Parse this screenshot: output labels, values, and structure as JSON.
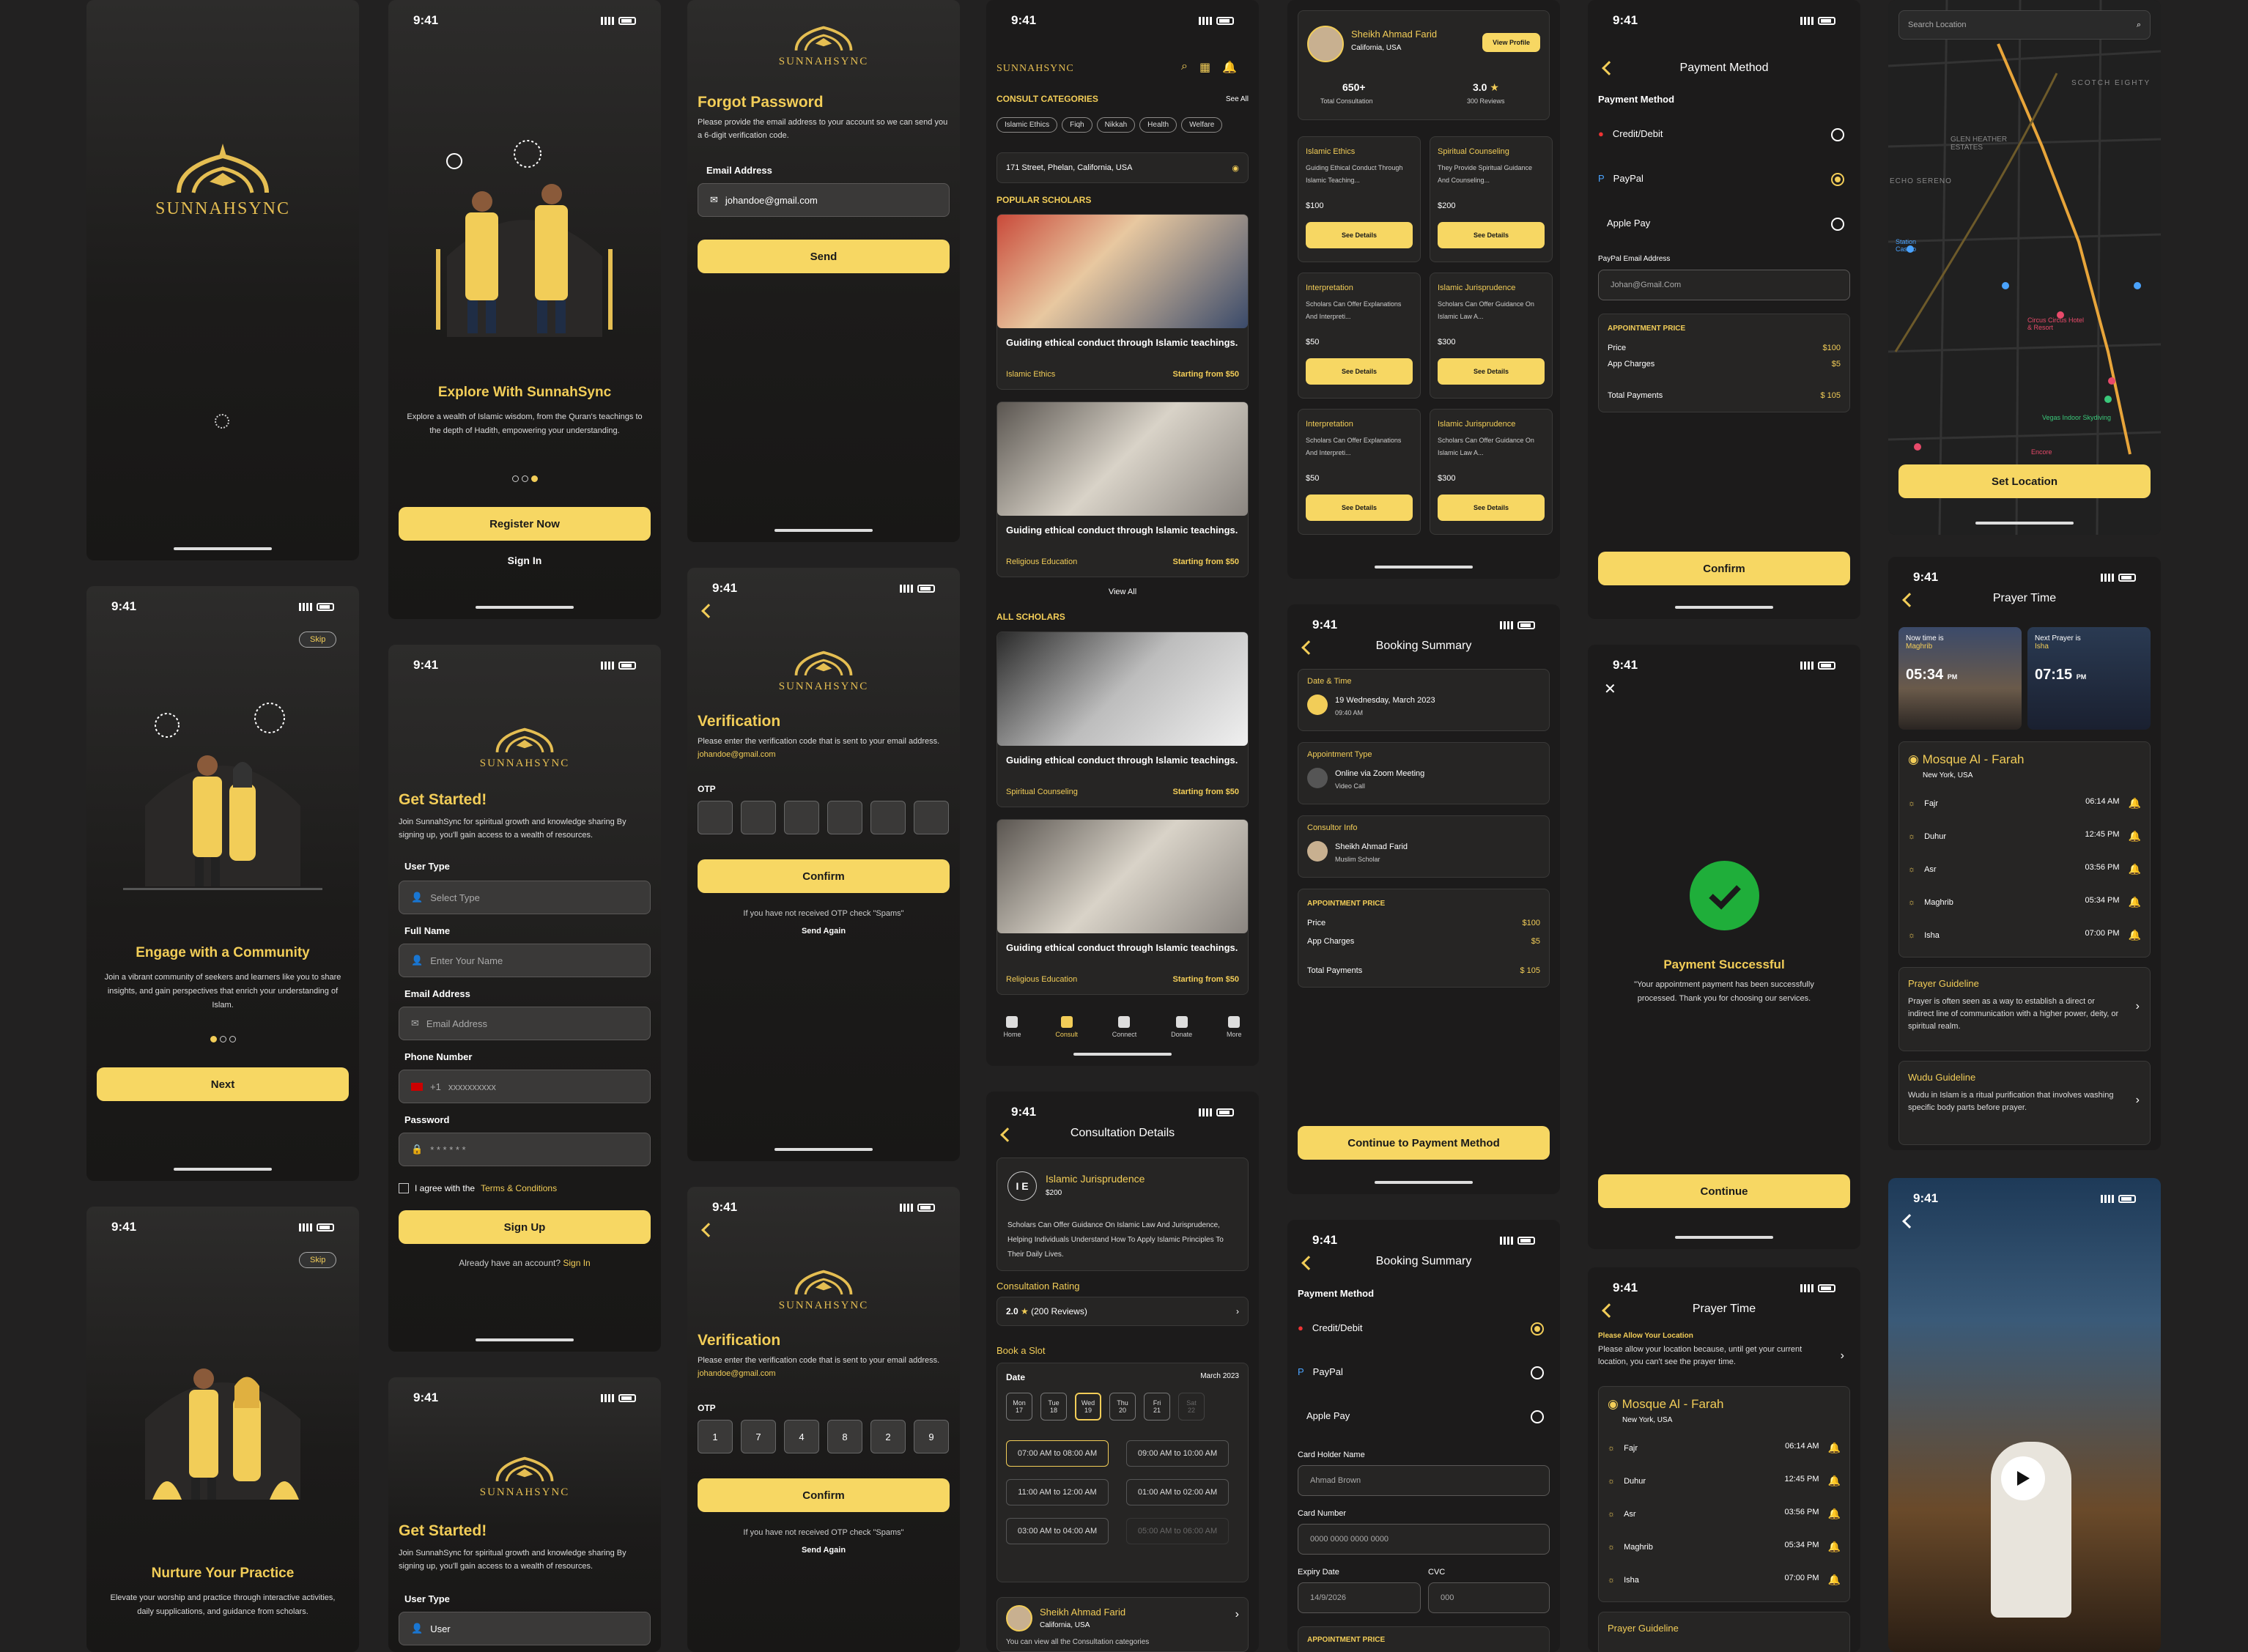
{
  "status_time": "9:41",
  "brand": "SUNNAHSYNC",
  "onboard1": {
    "title": "Explore With SunnahSync",
    "body": "Explore a wealth of Islamic wisdom, from the Quran's teachings to the depth of Hadith, empowering your understanding.",
    "register": "Register Now",
    "signin": "Sign In"
  },
  "onboard2": {
    "skip": "Skip",
    "title": "Engage with a Community",
    "body": "Join a vibrant community of seekers and learners like you to share insights, and gain perspectives that enrich your understanding of Islam.",
    "next": "Next"
  },
  "onboard3": {
    "skip": "Skip",
    "title": "Nurture Your Practice",
    "body": "Elevate your worship and practice through interactive activities, daily supplications, and guidance from scholars."
  },
  "signup": {
    "title": "Get Started!",
    "sub": "Join SunnahSync for spiritual growth and knowledge sharing By signing up, you'll gain access to a wealth of resources.",
    "user_type": "User Type",
    "user_ph": "Select Type",
    "full_name": "Full Name",
    "name_ph": "Enter Your Name",
    "email": "Email Address",
    "email_ph": "Email Address",
    "phone": "Phone Number",
    "cc": "+1",
    "phone_ph": "xxxxxxxxxx",
    "password": "Password",
    "pw_ph": "* * * * * *",
    "agree": "I agree with the",
    "terms": "Terms & Conditions",
    "btn": "Sign Up",
    "have": "Already have an account?",
    "signin": "Sign In"
  },
  "signup2": {
    "title": "Get Started!",
    "sub": "Join SunnahSync for spiritual growth and knowledge sharing By signing up, you'll gain access to a wealth of resources.",
    "user_type": "User Type",
    "user_val": "User"
  },
  "forgot": {
    "title": "Forgot Password",
    "sub": "Please provide the email address to your account so we can send you a 6-digit verification code.",
    "label": "Email Address",
    "value": "johandoe@gmail.com",
    "btn": "Send"
  },
  "verify": {
    "title": "Verification",
    "sub": "Please enter the verification code that is sent to your email address.",
    "email": "johandoe@gmail.com",
    "otp_label": "OTP",
    "otp": [
      "1",
      "7",
      "4",
      "8",
      "2",
      "9"
    ],
    "btn": "Confirm",
    "hint": "If you have not received OTP check \"Spams\"",
    "resend": "Send Again"
  },
  "home": {
    "consult": "CONSULT CATEGORIES",
    "see_all": "See All",
    "chips": [
      "Islamic Ethics",
      "Fiqh",
      "Nikkah",
      "Health",
      "Welfare"
    ],
    "address": "171 Street, Phelan, California, USA",
    "popular": "POPULAR SCHOLARS",
    "card_title": "Guiding ethical conduct through Islamic teachings.",
    "cats": [
      "Islamic Ethics",
      "Religious Education",
      "Spiritual Counseling",
      "Religious Education"
    ],
    "price": "Starting from $50",
    "view_all": "View All",
    "all": "ALL SCHOLARS",
    "tabs": [
      "Home",
      "Consult",
      "Connect",
      "Donate",
      "More"
    ]
  },
  "profile": {
    "name": "Sheikh Ahmad Farid",
    "loc": "California, USA",
    "view": "View Profile",
    "consults": "650+",
    "consults_l": "Total Consultation",
    "rating": "3.0",
    "reviews": "300 Reviews",
    "cards": [
      {
        "t": "Islamic Ethics",
        "d": "Guiding Ethical Conduct Through Islamic Teaching...",
        "p": "$100"
      },
      {
        "t": "Spiritual Counseling",
        "d": "They Provide Spiritual Guidance And Counseling...",
        "p": "$200"
      },
      {
        "t": "Interpretation",
        "d": "Scholars Can Offer Explanations And Interpreti...",
        "p": "$50"
      },
      {
        "t": "Islamic Jurisprudence",
        "d": "Scholars Can Offer Guidance On Islamic Law A...",
        "p": "$300"
      },
      {
        "t": "Interpretation",
        "d": "Scholars Can Offer Explanations And Interpreti...",
        "p": "$50"
      },
      {
        "t": "Islamic Jurisprudence",
        "d": "Scholars Can Offer Guidance On Islamic Law A...",
        "p": "$300"
      }
    ],
    "see": "See Details"
  },
  "consult_details": {
    "title": "Consultation Details",
    "cat": "Islamic Jurisprudence",
    "initials": "I E",
    "price": "$200",
    "desc": "Scholars Can Offer Guidance On Islamic Law And Jurisprudence, Helping Individuals Understand How To Apply Islamic Principles To Their Daily Lives.",
    "rating_h": "Consultation Rating",
    "rating": "2.0",
    "reviews": "(200 Reviews)",
    "book": "Book a Slot",
    "date": "Date",
    "month": "March 2023",
    "days": [
      [
        "Mon",
        "17"
      ],
      [
        "Tue",
        "18"
      ],
      [
        "Wed",
        "19"
      ],
      [
        "Thu",
        "20"
      ],
      [
        "Fri",
        "21"
      ],
      [
        "Sat",
        "22"
      ]
    ],
    "slots": [
      "07:00 AM to 08:00 AM",
      "09:00 AM to 10:00 AM",
      "11:00 AM to 12:00 AM",
      "01:00 AM to 02:00 AM",
      "03:00 AM to 04:00 AM",
      "05:00 AM to 06:00 AM"
    ],
    "scholar": "Sheikh Ahmad Farid",
    "loc": "California, USA",
    "note": "You can view all the Consultation categories"
  },
  "summary": {
    "title": "Booking Summary",
    "date_h": "Date & Time",
    "date": "19 Wednesday, March 2023",
    "time": "09:40 AM",
    "type_h": "Appointment Type",
    "type": "Online via Zoom Meeting",
    "type2": "Video Call",
    "cons_h": "Consultor Info",
    "cons": "Sheikh Ahmad Farid",
    "cons2": "Muslim Scholar",
    "price_h": "APPOINTMENT PRICE",
    "price_l": "Price",
    "price": "$100",
    "app_l": "App Charges",
    "app": "$5",
    "total_l": "Total Payments",
    "total": "$ 105",
    "btn": "Continue to Payment Method"
  },
  "pay": {
    "title": "Payment Method",
    "head": "Payment Method",
    "opts": [
      "Credit/Debit",
      "PayPal",
      "Apple Pay"
    ],
    "pp_label": "PayPal Email Address",
    "pp_val": "Johan@Gmail.Com",
    "holder": "Card Holder Name",
    "holder_val": "Ahmad Brown",
    "card": "Card Number",
    "card_val": "0000 0000 0000 0000",
    "exp": "Expiry Date",
    "exp_val": "14/9/2026",
    "cvc": "CVC",
    "cvc_val": "000",
    "confirm": "Confirm"
  },
  "success": {
    "title": "Payment Successful",
    "body": "\"Your appointment payment has been successfully processed. Thank you for choosing our services.",
    "btn": "Continue"
  },
  "map": {
    "search": "Search Location",
    "btn": "Set Location",
    "labels": [
      "SCOTCH EIGHTY",
      "GLEN HEATHER ESTATES",
      "ECHO SERENO",
      "Station Casino",
      "Circus Circus Hotel & Resort",
      "Vegas Indoor Skydiving",
      "Encore"
    ]
  },
  "prayer": {
    "title": "Prayer Time",
    "now_l": "Now time is",
    "now_p": "Maghrib",
    "now_t": "05:34",
    "next_l": "Next Prayer is",
    "next_p": "Isha",
    "next_t": "07:15",
    "pm": "PM",
    "mosque": "Mosque Al - Farah",
    "city": "New York, USA",
    "times": [
      [
        "Fajr",
        "06:14 AM"
      ],
      [
        "Duhur",
        "12:45 PM"
      ],
      [
        "Asr",
        "03:56 PM"
      ],
      [
        "Maghrib",
        "05:34 PM"
      ],
      [
        "Isha",
        "07:00 PM"
      ]
    ],
    "g1": "Prayer Guideline",
    "g1d": "Prayer is often seen as a way to establish a direct or indirect line of communication with a higher power, deity, or spiritual realm.",
    "g2": "Wudu Guideline",
    "g2d": "Wudu in Islam is a ritual purification that involves washing specific body parts before prayer.",
    "allow_h": "Please Allow Your Location",
    "allow": "Please allow your location because, until get your current location, you can't see the prayer time."
  }
}
